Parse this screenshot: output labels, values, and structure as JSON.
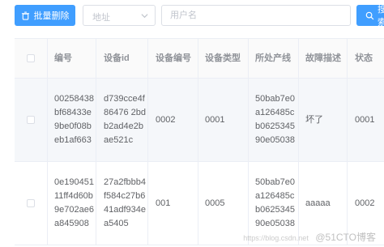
{
  "toolbar": {
    "batch_delete_label": "批量删除",
    "address_placeholder": "地址",
    "username_placeholder": "用户名",
    "search_label": "搜索"
  },
  "table": {
    "columns": [
      "编号",
      "设备id",
      "设备编号",
      "设备类型",
      "所处产线",
      "故障描述",
      "状态"
    ],
    "rows": [
      {
        "id": "00258438bf68433e9be0f08beb1af663",
        "device_id": "d739cce4f86476 2bdb2ad4e2bae521c",
        "device_no": "0002",
        "device_type": "0001",
        "line": "50bab7e0a126485cb062534590e05038",
        "fault": "坏了",
        "status": "0001"
      },
      {
        "id": "0e19045111ff4d60b9e702ae6a845908",
        "device_id": "27a2fbbb4f584c27b641adf934ea5405",
        "device_no": "001",
        "device_type": "0005",
        "line": "50bab7e0a126485cb062534590e05038",
        "fault": "aaaaa",
        "status": "0002"
      }
    ]
  },
  "watermark": {
    "url": "https://blog.csdn.net",
    "brand": "@51CTO博客"
  },
  "colors": {
    "primary": "#409eff",
    "border": "#ebeef5",
    "header_text": "#909399"
  }
}
